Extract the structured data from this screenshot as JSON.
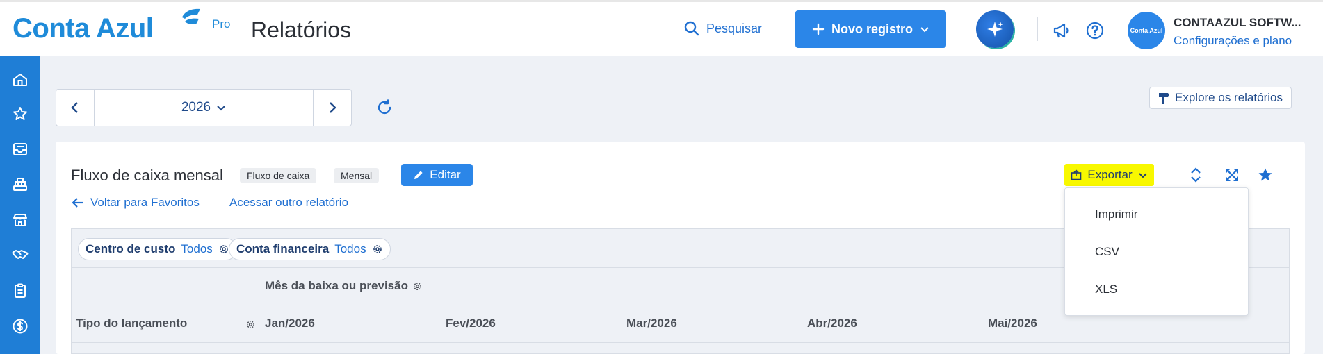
{
  "header": {
    "logo_text": "Conta Azul",
    "logo_badge": "Pro",
    "page_title": "Relatórios",
    "search_label": "Pesquisar",
    "new_record_label": "Novo registro",
    "company_name": "CONTAAZUL SOFTW...",
    "company_settings": "Configurações e plano",
    "avatar_text": "Conta Azul"
  },
  "sidebar": {
    "items": [
      "home-icon",
      "star-icon",
      "inbox-icon",
      "cash-register-icon",
      "store-icon",
      "handshake-icon",
      "clipboard-icon",
      "dollar-icon"
    ]
  },
  "period": {
    "year": "2026"
  },
  "toolbar": {
    "explore_label": "Explore os relatórios"
  },
  "report": {
    "title": "Fluxo de caixa mensal",
    "tags": [
      "Fluxo de caixa",
      "Mensal"
    ],
    "edit_label": "Editar",
    "back_label": "Voltar para Favoritos",
    "other_label": "Acessar outro relatório",
    "export_label": "Exportar"
  },
  "filters": [
    {
      "key": "Centro de custo",
      "value": "Todos"
    },
    {
      "key": "Conta financeira",
      "value": "Todos"
    }
  ],
  "table": {
    "group_label": "Mês da baixa ou previsão",
    "type_column": "Tipo do lançamento",
    "months": [
      "Jan/2026",
      "Fev/2026",
      "Mar/2026",
      "Abr/2026",
      "Mai/2026"
    ]
  },
  "export_menu": {
    "items": [
      "Imprimir",
      "CSV",
      "XLS"
    ]
  },
  "colors": {
    "primary": "#2b86e8",
    "sidebar": "#1f7ed6",
    "highlight": "#f8f800"
  }
}
